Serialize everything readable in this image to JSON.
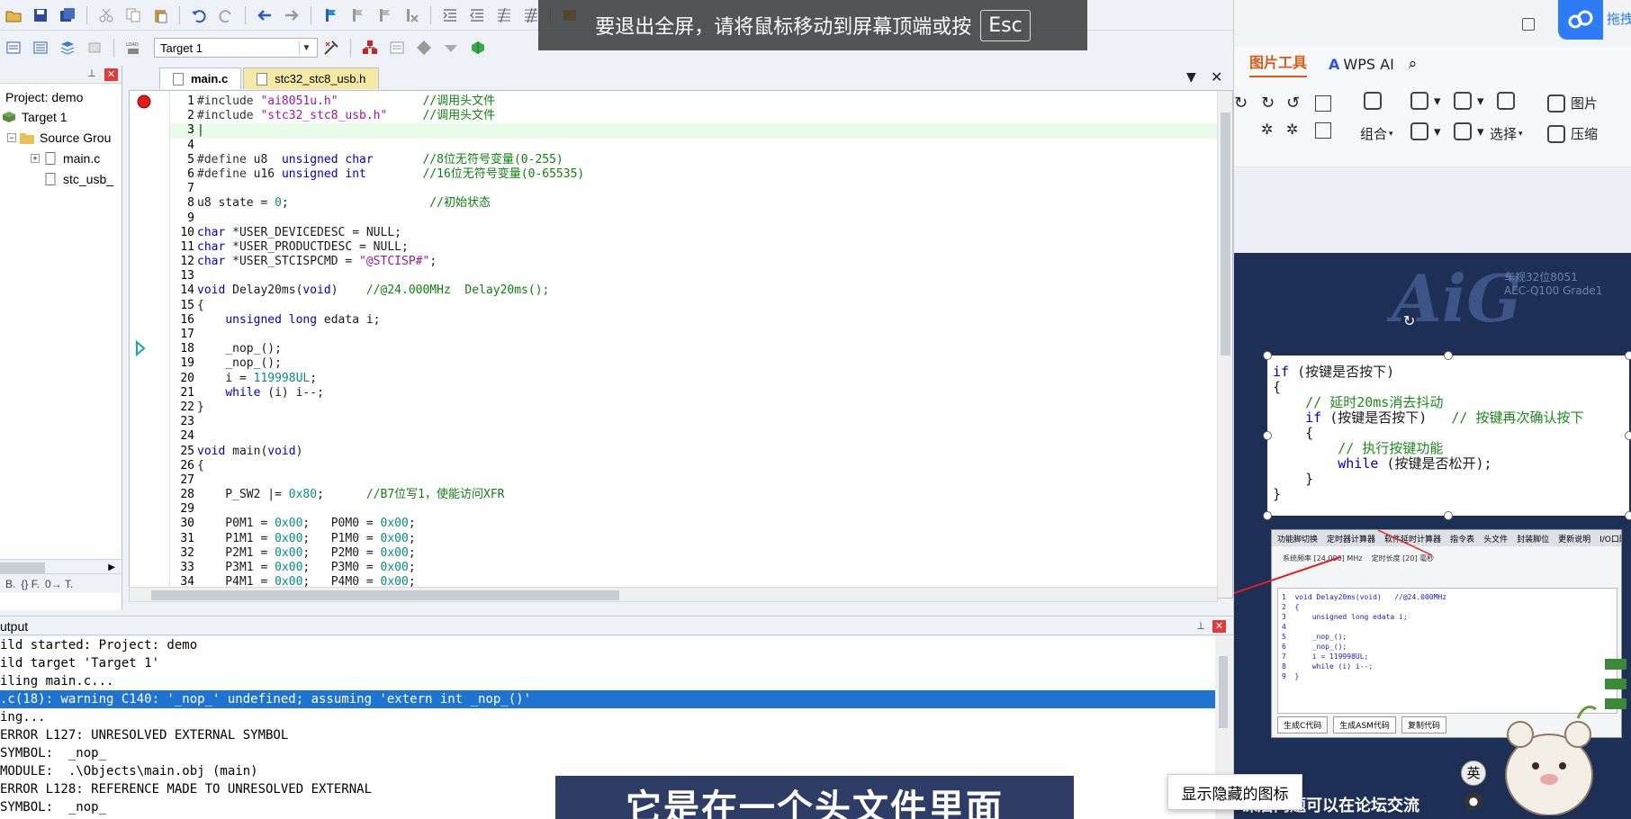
{
  "ide": {
    "target_select": "Target 1",
    "project_pane": {
      "title": "Project: demo",
      "items": [
        "Target 1",
        "Source Grou",
        "main.c",
        "stc_usb_"
      ],
      "tabs": [
        "B.",
        "{} F.",
        "0→ T."
      ]
    },
    "editor_tabs": [
      "main.c",
      "stc32_stc8_usb.h"
    ],
    "code_lines": [
      {
        "n": "1",
        "parts": [
          [
            "dir",
            "#include "
          ],
          [
            "str",
            "\"ai8051u.h\""
          ],
          [
            "ct",
            "            "
          ],
          [
            "com",
            "//调用头文件"
          ]
        ]
      },
      {
        "n": "2",
        "parts": [
          [
            "dir",
            "#include "
          ],
          [
            "str",
            "\"stc32_stc8_usb.h\""
          ],
          [
            "ct",
            "     "
          ],
          [
            "com",
            "//调用头文件"
          ]
        ]
      },
      {
        "n": "3",
        "parts": [
          [
            "ct",
            "|"
          ]
        ]
      },
      {
        "n": "4",
        "parts": []
      },
      {
        "n": "5",
        "parts": [
          [
            "dir",
            "#define "
          ],
          [
            "ct",
            "u8  "
          ],
          [
            "kw",
            "unsigned char"
          ],
          [
            "ct",
            "       "
          ],
          [
            "com",
            "//8位无符号变量(0-255)"
          ]
        ]
      },
      {
        "n": "6",
        "parts": [
          [
            "dir",
            "#define "
          ],
          [
            "ct",
            "u16 "
          ],
          [
            "kw",
            "unsigned int"
          ],
          [
            "ct",
            "        "
          ],
          [
            "com",
            "//16位无符号变量(0-65535)"
          ]
        ]
      },
      {
        "n": "7",
        "parts": []
      },
      {
        "n": "8",
        "parts": [
          [
            "ct",
            "u8 state = "
          ],
          [
            "num",
            "0"
          ],
          [
            "ct",
            ";                    "
          ],
          [
            "com",
            "//初始状态"
          ]
        ]
      },
      {
        "n": "9",
        "parts": []
      },
      {
        "n": "10",
        "parts": [
          [
            "kw",
            "char"
          ],
          [
            "ct",
            " *USER_DEVICEDESC = NULL;"
          ]
        ]
      },
      {
        "n": "11",
        "parts": [
          [
            "kw",
            "char"
          ],
          [
            "ct",
            " *USER_PRODUCTDESC = NULL;"
          ]
        ]
      },
      {
        "n": "12",
        "parts": [
          [
            "kw",
            "char"
          ],
          [
            "ct",
            " *USER_STCISPCMD = "
          ],
          [
            "str",
            "\"@STCISP#\""
          ],
          [
            "ct",
            ";"
          ]
        ]
      },
      {
        "n": "13",
        "parts": []
      },
      {
        "n": "14",
        "parts": [
          [
            "kw",
            "void"
          ],
          [
            "ct",
            " Delay20ms("
          ],
          [
            "kw",
            "void"
          ],
          [
            "ct",
            ")    "
          ],
          [
            "com",
            "//@24.000MHz  Delay20ms();"
          ]
        ]
      },
      {
        "n": "15",
        "parts": [
          [
            "ct",
            "{"
          ]
        ]
      },
      {
        "n": "16",
        "parts": [
          [
            "ct",
            "    "
          ],
          [
            "kw",
            "unsigned long"
          ],
          [
            "ct",
            " edata i;"
          ]
        ]
      },
      {
        "n": "17",
        "parts": []
      },
      {
        "n": "18",
        "parts": [
          [
            "ct",
            "    _nop_();"
          ]
        ]
      },
      {
        "n": "19",
        "parts": [
          [
            "ct",
            "    _nop_();"
          ]
        ]
      },
      {
        "n": "20",
        "parts": [
          [
            "ct",
            "    i = "
          ],
          [
            "num",
            "119998UL"
          ],
          [
            "ct",
            ";"
          ]
        ]
      },
      {
        "n": "21",
        "parts": [
          [
            "ct",
            "    "
          ],
          [
            "kw",
            "while"
          ],
          [
            "ct",
            " (i) i--;"
          ]
        ]
      },
      {
        "n": "22",
        "parts": [
          [
            "ct",
            "}"
          ]
        ]
      },
      {
        "n": "23",
        "parts": []
      },
      {
        "n": "24",
        "parts": []
      },
      {
        "n": "25",
        "parts": [
          [
            "kw",
            "void"
          ],
          [
            "ct",
            " main("
          ],
          [
            "kw",
            "void"
          ],
          [
            "ct",
            ")"
          ]
        ]
      },
      {
        "n": "26",
        "parts": [
          [
            "ct",
            "{"
          ]
        ]
      },
      {
        "n": "27",
        "parts": []
      },
      {
        "n": "28",
        "parts": [
          [
            "ct",
            "    P_SW2 |= "
          ],
          [
            "num",
            "0x80"
          ],
          [
            "ct",
            ";      "
          ],
          [
            "com",
            "//B7位写1，使能访问XFR"
          ]
        ]
      },
      {
        "n": "29",
        "parts": []
      },
      {
        "n": "30",
        "parts": [
          [
            "ct",
            "    P0M1 = "
          ],
          [
            "num",
            "0x00"
          ],
          [
            "ct",
            ";   P0M0 = "
          ],
          [
            "num",
            "0x00"
          ],
          [
            "ct",
            ";"
          ]
        ]
      },
      {
        "n": "31",
        "parts": [
          [
            "ct",
            "    P1M1 = "
          ],
          [
            "num",
            "0x00"
          ],
          [
            "ct",
            ";   P1M0 = "
          ],
          [
            "num",
            "0x00"
          ],
          [
            "ct",
            ";"
          ]
        ]
      },
      {
        "n": "32",
        "parts": [
          [
            "ct",
            "    P2M1 = "
          ],
          [
            "num",
            "0x00"
          ],
          [
            "ct",
            ";   P2M0 = "
          ],
          [
            "num",
            "0x00"
          ],
          [
            "ct",
            ";"
          ]
        ]
      },
      {
        "n": "33",
        "parts": [
          [
            "ct",
            "    P3M1 = "
          ],
          [
            "num",
            "0x00"
          ],
          [
            "ct",
            ";   P3M0 = "
          ],
          [
            "num",
            "0x00"
          ],
          [
            "ct",
            ";"
          ]
        ]
      },
      {
        "n": "34",
        "parts": [
          [
            "ct",
            "    P4M1 = "
          ],
          [
            "num",
            "0x00"
          ],
          [
            "ct",
            ";   P4M0 = "
          ],
          [
            "num",
            "0x00"
          ],
          [
            "ct",
            ";"
          ]
        ]
      }
    ],
    "output": {
      "title": "utput",
      "lines": [
        "ild started: Project: demo",
        "ild target 'Target 1'",
        "iling main.c...",
        ".c(18): warning C140: '_nop_' undefined; assuming 'extern int _nop_()'",
        "ing...",
        "ERROR L127: UNRESOLVED EXTERNAL SYMBOL",
        "SYMBOL:  _nop_",
        "MODULE:  .\\Objects\\main.obj (main)",
        "ERROR L128: REFERENCE MADE TO UNRESOLVED EXTERNAL",
        "SYMBOL:  _nop_"
      ],
      "selected_index": 3
    }
  },
  "overlay": {
    "esc_message": "要退出全屏，请将鼠标移动到屏幕顶端或按",
    "esc_key": "Esc",
    "subtitle": "它是在一个头文件里面",
    "tooltip": "显示隐藏的图标"
  },
  "wps": {
    "drag_label": "拖拽",
    "menu_active": "图片工具",
    "menu_ai": "WPS AI",
    "ribbon": {
      "combine": "组合",
      "select": "选择",
      "pic": "图片",
      "compress": "压缩"
    },
    "slide": {
      "logo": "AiG",
      "logo_sub_1": "车规32位8051",
      "logo_sub_2": "AEC-Q100 Grade1",
      "card_lines": [
        [
          [
            "kw",
            "if"
          ],
          [
            "ct",
            " (按键是否按下)"
          ]
        ],
        [
          [
            "ct",
            "{"
          ]
        ],
        [
          [
            "ct",
            "    "
          ],
          [
            "com",
            "// 延时20ms消去抖动"
          ]
        ],
        [
          [
            "ct",
            "    "
          ],
          [
            "kw",
            "if"
          ],
          [
            "ct",
            " (按键是否按下)   "
          ],
          [
            "com",
            "// 按键再次确认按下"
          ]
        ],
        [
          [
            "ct",
            "    {"
          ]
        ],
        [
          [
            "ct",
            "        "
          ],
          [
            "com",
            "// 执行按键功能"
          ]
        ],
        [
          [
            "ct",
            "        "
          ],
          [
            "kw",
            "while"
          ],
          [
            "ct",
            " (按键是否松开);"
          ]
        ],
        [
          [
            "ct",
            "    }"
          ]
        ],
        [
          [
            "ct",
            "}"
          ]
        ]
      ],
      "tool_tabs": [
        "功能脚切换",
        "定时器计算器",
        "软件延时计算器",
        "指令表",
        "头文件",
        "封装脚位",
        "更新说明",
        "I/O口配置工具"
      ],
      "tool_code": "1  void Delay20ms(void)   //@24.000MHz\n2  {\n3      unsigned long edata i;\n4\n5      _nop_();\n6      _nop_();\n7      i = 119998UL;\n8      while (i) i--;\n9  }",
      "tool_buttons": [
        "生成C代码",
        "生成ASM代码",
        "复制代码"
      ],
      "footer": "课后问题可以在论坛交流"
    },
    "ime_top": "英"
  }
}
